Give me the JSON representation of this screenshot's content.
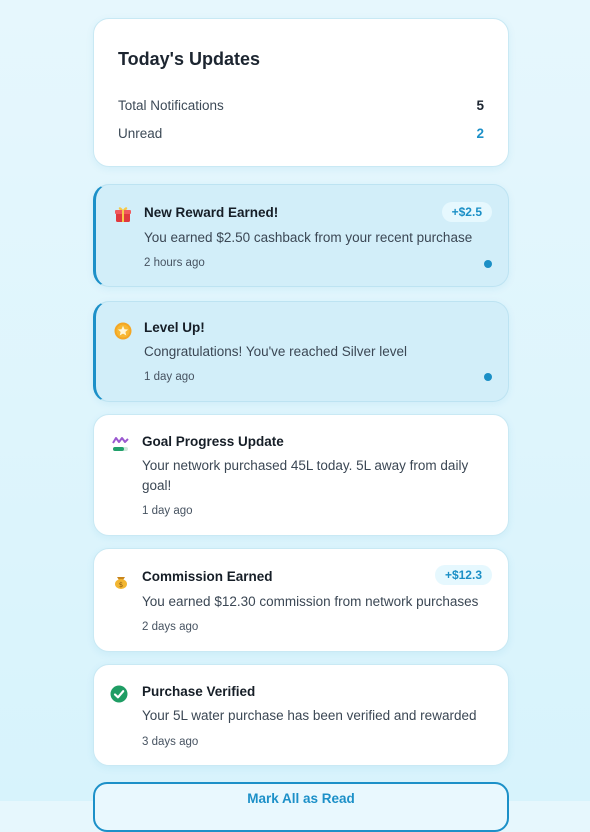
{
  "summary": {
    "title": "Today's Updates",
    "total_label": "Total Notifications",
    "total_value": "5",
    "unread_label": "Unread",
    "unread_value": "2"
  },
  "notifications": [
    {
      "icon": "gift-icon",
      "title": "New Reward Earned!",
      "message": "You earned $2.50 cashback from your recent purchase",
      "time": "2 hours ago",
      "badge": "+$2.5",
      "unread": true
    },
    {
      "icon": "star-medal-icon",
      "title": "Level Up!",
      "message": "Congratulations! You've reached Silver level",
      "time": "1 day ago",
      "badge": "",
      "unread": true
    },
    {
      "icon": "progress-chart-icon",
      "title": "Goal Progress Update",
      "message": "Your network purchased 45L today. 5L away from daily goal!",
      "time": "1 day ago",
      "badge": "",
      "unread": false
    },
    {
      "icon": "coin-bag-icon",
      "title": "Commission Earned",
      "message": "You earned $12.30 commission from network purchases",
      "time": "2 days ago",
      "badge": "+$12.3",
      "unread": false
    },
    {
      "icon": "check-circle-icon",
      "title": "Purchase Verified",
      "message": "Your 5L water purchase has been verified and rewarded",
      "time": "3 days ago",
      "badge": "",
      "unread": false
    }
  ],
  "actions": {
    "mark_all_label": "Mark All as Read"
  },
  "colors": {
    "accent": "#1c90c8",
    "unread_bg": "#d2eef9",
    "badge_bg": "#e6f8fe"
  }
}
